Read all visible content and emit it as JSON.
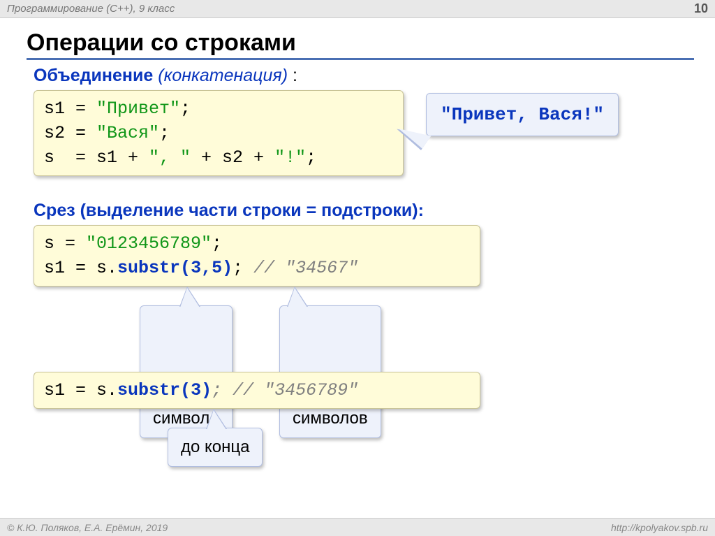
{
  "header": {
    "course": "Программирование (C++), 9 класс",
    "page": "10"
  },
  "title": "Операции со строками",
  "concat": {
    "label_bold": "Объединение",
    "label_ital": "(конкатенация)",
    "colon": " :",
    "code": {
      "l1a": "s1 = ",
      "l1s": "\"Привет\"",
      "l1b": ";",
      "l2a": "s2 = ",
      "l2s": "\"Вася\"",
      "l2b": ";",
      "l3a": "s  = s1 + ",
      "l3s1": "\", \"",
      "l3b": " + s2 + ",
      "l3s2": "\"!\"",
      "l3c": ";"
    },
    "result": "\"Привет, Вася!\""
  },
  "slice": {
    "label": "Срез (выделение части строки = подстроки):",
    "code1": {
      "l1a": "s = ",
      "l1s": "\"0123456789\"",
      "l1b": ";",
      "l2a": "s1 = s.",
      "l2k": "substr(",
      "l2n1": "3",
      "l2m": ",",
      "l2n2": "5",
      "l2k2": ")",
      "l2b": ";",
      "l2c": " // \"34567\""
    },
    "callout_from": "с какого\nсимвола",
    "callout_count": "сколько\nсимволов",
    "code2": {
      "a": "s1 = s.",
      "k": "substr(",
      "n": "3",
      "k2": ")",
      "b": ";",
      "c": " // \"3456789\""
    },
    "callout_end": "до конца"
  },
  "footer": {
    "left": "© К.Ю. Поляков, Е.А. Ерёмин, 2019",
    "right": "http://kpolyakov.spb.ru"
  }
}
